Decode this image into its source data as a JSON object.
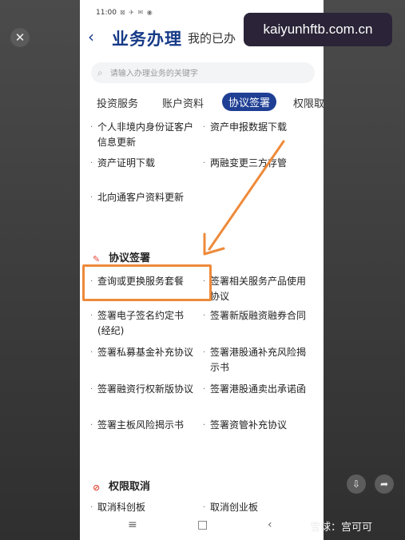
{
  "overlay": {
    "url_text": "kaiyunhftb.com.cn",
    "watermark": "雪球：宫可可"
  },
  "status_bar": {
    "time": "11:00",
    "icons": "⊠ ✈ ✉ ◉"
  },
  "header": {
    "back": "‹",
    "title": "业务办理",
    "subtitle": "我的已办"
  },
  "search": {
    "placeholder": "请输入办理业务的关键字"
  },
  "tabs": [
    "投资服务",
    "账户资料",
    "协议签署",
    "权限取"
  ],
  "active_tab": "协议签署",
  "top_items": [
    [
      "个人非境内身份证客户信息更新",
      "资产申报数据下载"
    ],
    [
      "资产证明下载",
      "两融变更三方存管"
    ],
    [
      "北向通客户资料更新",
      ""
    ]
  ],
  "section1": {
    "title": "协议签署"
  },
  "section1_items": [
    [
      "查询或更换服务套餐",
      "签署相关服务产品使用协议"
    ],
    [
      "签署电子签名约定书(经纪)",
      "签署新版融资融券合同"
    ],
    [
      "签署私募基金补充协议",
      "签署港股通补充风险揭示书"
    ],
    [
      "签署融资行权新版协议",
      "签署港股通卖出承诺函"
    ],
    [
      "签署主板风险揭示书",
      "签署资管补充协议"
    ]
  ],
  "section2": {
    "title": "权限取消"
  },
  "section2_items": [
    [
      "取消科创板",
      "取消创业板"
    ]
  ],
  "nav": {
    "menu": "≡",
    "home": "□",
    "back": "‹"
  },
  "accent_color": "#1e3f94",
  "highlight_color": "#ee8a3a"
}
